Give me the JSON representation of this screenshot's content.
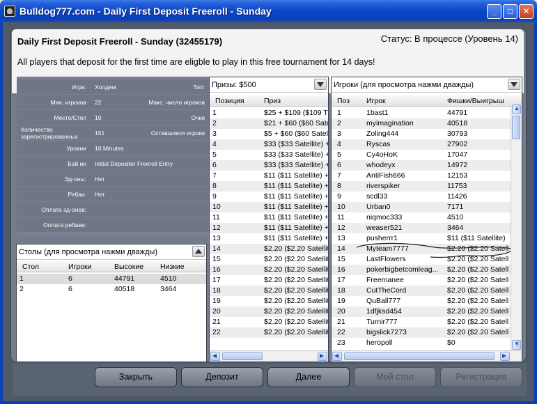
{
  "window": {
    "title": "Bulldog777.com - Daily First Deposit Freeroll - Sunday"
  },
  "header": {
    "tournament_name": "Daily First Deposit Freeroll - Sunday (32455179)",
    "status": "Статус: В процессе (Уровень 14)",
    "description": "All players that deposit for the first time are eligble to play in this free tournament for 14 days!"
  },
  "info": {
    "game_label": "Игра:",
    "game_value": "Холдем",
    "type_label": "Тип:",
    "type_value": "",
    "min_players_label": "Мин. игроков",
    "min_players_value": "22",
    "max_players_label": "Макс. число игроков",
    "max_players_value": "",
    "seat_label": "Место/Стол",
    "seat_value": "10",
    "points_label": "Очки",
    "points_value": "",
    "registered_label": "Количество зарегистрированных",
    "registered_value": "151",
    "remaining_label": "Оставшиеся игроки",
    "remaining_value": "",
    "levels_label": "Уровни",
    "levels_value": "10 Minutes",
    "buyin_label": "Бай ин",
    "buyin_value": "Initial Depositor Freeroll Entry",
    "addons_label": "Эд-оны:",
    "addons_value": "Нет",
    "rebuys_label": "Ребаи:",
    "rebuys_value": "Нет",
    "addon_payment_label": "Оплата эд-онов:",
    "addon_payment_value": "",
    "rebuy_payment_label": "Оплата ребаев:",
    "rebuy_payment_value": ""
  },
  "tables": {
    "caption": "Столы (для просмотра нажми дважды)",
    "columns": [
      "Стол",
      "Игроки",
      "Высокие",
      "Низкие"
    ],
    "rows": [
      [
        "1",
        "6",
        "44791",
        "4510"
      ],
      [
        "2",
        "6",
        "40518",
        "3464"
      ]
    ]
  },
  "prizes": {
    "caption": "Призы: $500",
    "columns": [
      "Позиция",
      "Приз"
    ],
    "rows": [
      [
        "1",
        "$25 + $109 ($109 T"
      ],
      [
        "2",
        "$21 + $60 ($60 Satell"
      ],
      [
        "3",
        "$5 + $60 ($60 Satell"
      ],
      [
        "4",
        "$33 ($33 Satellite) +"
      ],
      [
        "5",
        "$33 ($33 Satellite) +"
      ],
      [
        "6",
        "$33 ($33 Satellite) +"
      ],
      [
        "7",
        "$11 ($11 Satellite) +"
      ],
      [
        "8",
        "$11 ($11 Satellite) +"
      ],
      [
        "9",
        "$11 ($11 Satellite) +"
      ],
      [
        "10",
        "$11 ($11 Satellite) +"
      ],
      [
        "11",
        "$11 ($11 Satellite) +"
      ],
      [
        "12",
        "$11 ($11 Satellite) +"
      ],
      [
        "13",
        "$11 ($11 Satellite) +"
      ],
      [
        "14",
        "$2.20 ($2.20 Satellit"
      ],
      [
        "15",
        "$2.20 ($2.20 Satellit"
      ],
      [
        "16",
        "$2.20 ($2.20 Satellit"
      ],
      [
        "17",
        "$2.20 ($2.20 Satellit"
      ],
      [
        "18",
        "$2.20 ($2.20 Satellit"
      ],
      [
        "19",
        "$2.20 ($2.20 Satellit"
      ],
      [
        "20",
        "$2.20 ($2.20 Satellit"
      ],
      [
        "21",
        "$2.20 ($2.20 Satellit"
      ],
      [
        "22",
        "$2.20 ($2.20 Satellit"
      ]
    ]
  },
  "players": {
    "caption": "Игроки (для просмотра нажми дважды)",
    "columns": [
      "Поз",
      "Игрок",
      "Фишки/Выигрыш"
    ],
    "rows": [
      [
        "1",
        "1bast1",
        "44791"
      ],
      [
        "2",
        "myimagination",
        "40518"
      ],
      [
        "3",
        "Zoling444",
        "30793"
      ],
      [
        "4",
        "Ryscas",
        "27902"
      ],
      [
        "5",
        "Cy4oHoK",
        "17047"
      ],
      [
        "6",
        "whodeyx",
        "14972"
      ],
      [
        "7",
        "AntiFish666",
        "12153"
      ],
      [
        "8",
        "riverspiker",
        "11753"
      ],
      [
        "9",
        "scdl33",
        "11426"
      ],
      [
        "10",
        "Urban0",
        "7171"
      ],
      [
        "11",
        "niqmoc333",
        "4510"
      ],
      [
        "12",
        "weaser521",
        "3464"
      ],
      [
        "13",
        "pusherrr1",
        "$11 ($11 Satellite)"
      ],
      [
        "14",
        "Myteam7777",
        "$2.20 ($2.20 Satell"
      ],
      [
        "15",
        "LastFlowers",
        "$2.20 ($2.20 Satell"
      ],
      [
        "16",
        "pokerbigbetcomleag...",
        "$2.20 ($2.20 Satell"
      ],
      [
        "17",
        "Freemanee",
        "$2.20 ($2.20 Satell"
      ],
      [
        "18",
        "CutTheCord",
        "$2.20 ($2.20 Satell"
      ],
      [
        "19",
        "QuBall777",
        "$2.20 ($2.20 Satell"
      ],
      [
        "20",
        "1dfjksd454",
        "$2.20 ($2.20 Satell"
      ],
      [
        "21",
        "Turnir777",
        "$2.20 ($2.20 Satell"
      ],
      [
        "22",
        "bigslick7273",
        "$2.20 ($2.20 Satell"
      ],
      [
        "23",
        "heropoll",
        "$0"
      ]
    ]
  },
  "buttons": {
    "close": "Закрыть",
    "deposit": "Депозит",
    "next": "Далее",
    "my_table": "Мой стол",
    "register": "Регистрация"
  }
}
